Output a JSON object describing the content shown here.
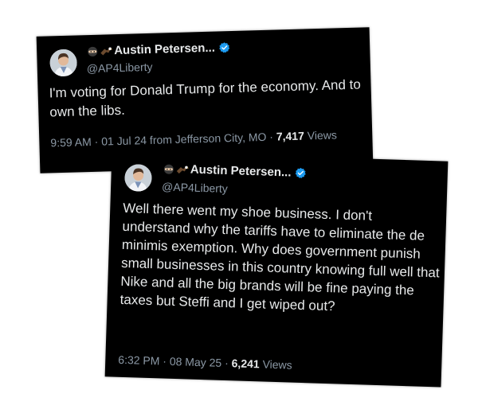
{
  "colors": {
    "card_bg": "#000000",
    "text_primary": "#e7e9ea",
    "text_secondary": "#8b98a5",
    "verified_blue": "#1d9bf0",
    "page_bg": "#ffffff"
  },
  "tweets": [
    {
      "display_name": "Austin Petersen...",
      "handle": "@AP4Liberty",
      "emojis": [
        "ninja-emoji",
        "eagle-emoji"
      ],
      "verified": true,
      "text": "I'm voting for Donald Trump for the economy. And to own the libs.",
      "time": "9:59 AM",
      "date": "01 Jul 24",
      "location": "from Jefferson City, MO",
      "views_count": "7,417",
      "views_label": "Views"
    },
    {
      "display_name": "Austin Petersen...",
      "handle": "@AP4Liberty",
      "emojis": [
        "ninja-emoji",
        "eagle-emoji"
      ],
      "verified": true,
      "text": "Well there went my shoe business. I don't understand why the tariffs have to eliminate the de minimis exemption. Why does government punish small businesses in this country knowing full well that Nike and all the big brands will be fine paying the taxes but Steffi and I get wiped out?",
      "time": "6:32 PM",
      "date": "08 May 25",
      "views_count": "6,241",
      "views_label": "Views"
    }
  ],
  "separator": "·"
}
